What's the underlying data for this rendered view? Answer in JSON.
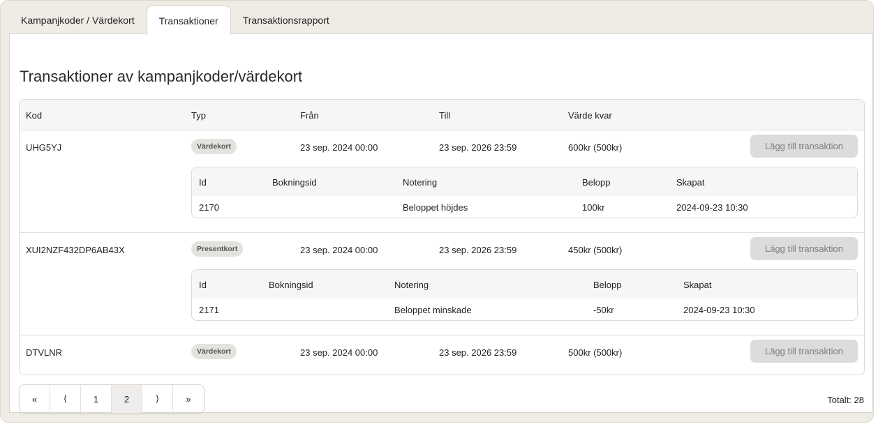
{
  "tabs": [
    {
      "label": "Kampanjkoder / Värdekort",
      "active": false
    },
    {
      "label": "Transaktioner",
      "active": true
    },
    {
      "label": "Transaktionsrapport",
      "active": false
    }
  ],
  "page_title": "Transaktioner av kampanjkoder/värdekort",
  "table": {
    "headers": {
      "code": "Kod",
      "type": "Typ",
      "from": "Från",
      "to": "Till",
      "value_left": "Värde kvar"
    },
    "sub_headers": {
      "id": "Id",
      "booking_id": "Bokningsid",
      "note": "Notering",
      "amount": "Belopp",
      "created": "Skapat"
    },
    "add_button_label": "Lägg till transaktion",
    "rows": [
      {
        "code": "UHG5YJ",
        "type": "Värdekort",
        "from": "23 sep. 2024 00:00",
        "to": "23 sep. 2026 23:59",
        "value_left": "600kr (500kr)",
        "transactions": [
          {
            "id": "2170",
            "booking_id": "",
            "note": "Beloppet höjdes",
            "amount": "100kr",
            "created": "2024-09-23 10:30"
          }
        ]
      },
      {
        "code": "XUI2NZF432DP6AB43X",
        "type": "Presentkort",
        "from": "23 sep. 2024 00:00",
        "to": "23 sep. 2026 23:59",
        "value_left": "450kr (500kr)",
        "transactions": [
          {
            "id": "2171",
            "booking_id": "",
            "note": "Beloppet minskade",
            "amount": "-50kr",
            "created": "2024-09-23 10:30"
          }
        ]
      },
      {
        "code": "DTVLNR",
        "type": "Värdekort",
        "from": "23 sep. 2024 00:00",
        "to": "23 sep. 2026 23:59",
        "value_left": "500kr (500kr)",
        "transactions": []
      }
    ]
  },
  "pagination": {
    "first": "«",
    "prev": "⟨",
    "pages": [
      "1",
      "2"
    ],
    "current": "2",
    "next": "⟩",
    "last": "»"
  },
  "total": "Totalt: 28"
}
